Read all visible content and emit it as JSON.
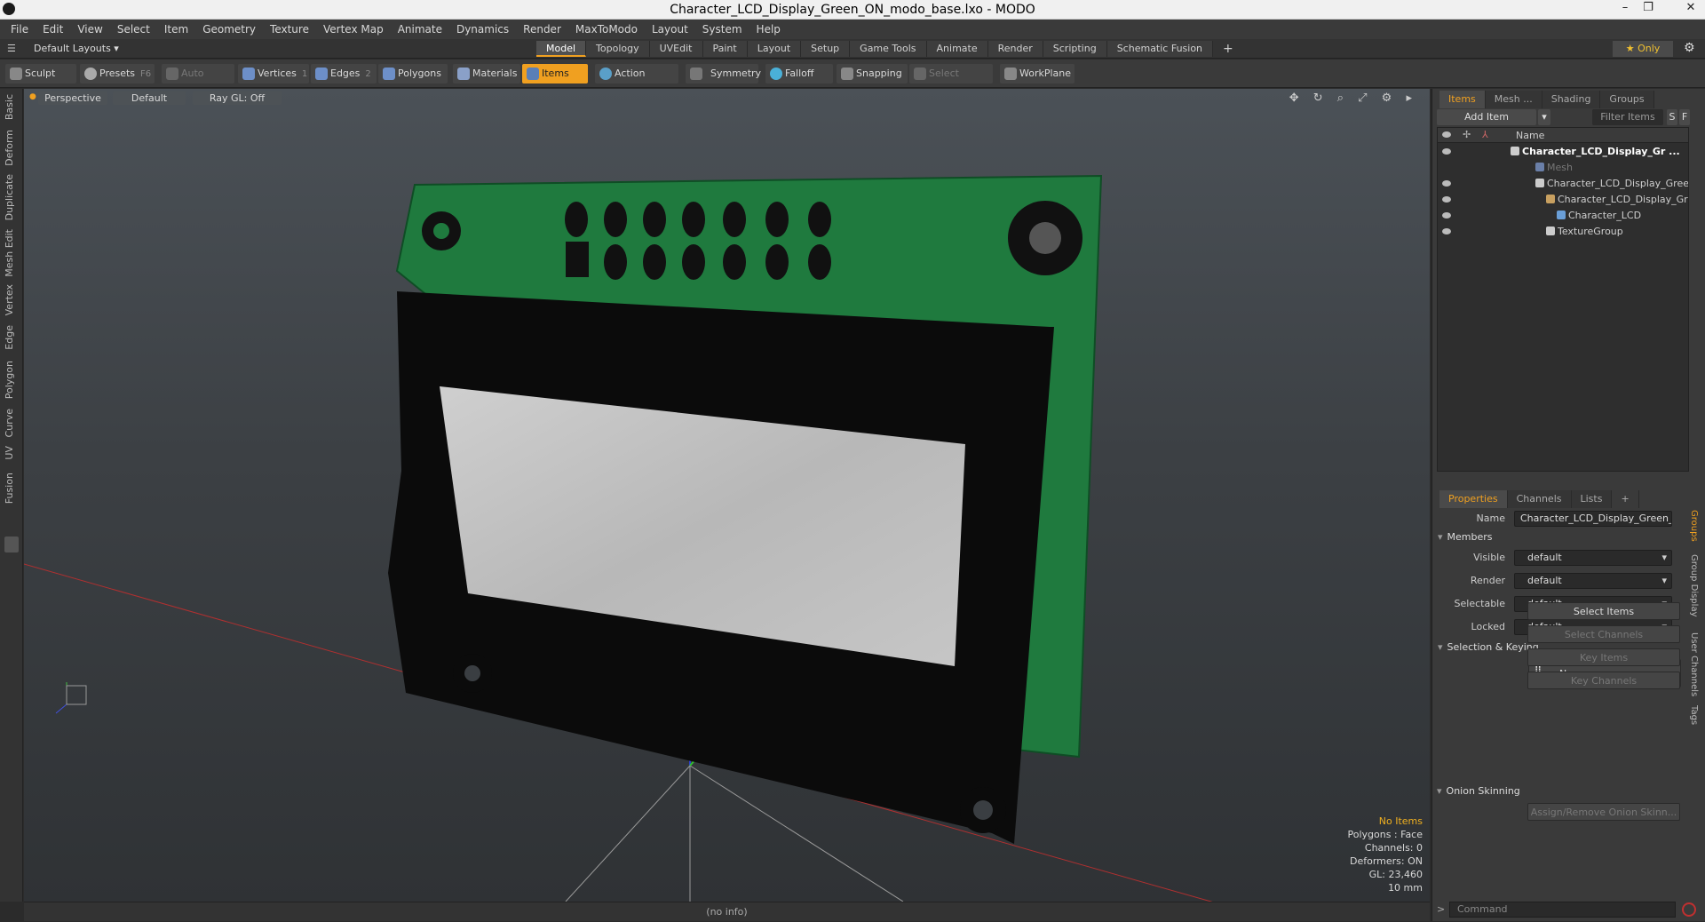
{
  "window": {
    "title": "Character_LCD_Display_Green_ON_modo_base.lxo - MODO",
    "minimize": "–",
    "restore": "❐",
    "close": "✕"
  },
  "menu": [
    "File",
    "Edit",
    "View",
    "Select",
    "Item",
    "Geometry",
    "Texture",
    "Vertex Map",
    "Animate",
    "Dynamics",
    "Render",
    "MaxToModo",
    "Layout",
    "System",
    "Help"
  ],
  "layout": {
    "preset": "Default Layouts ▾",
    "tabs": [
      "Model",
      "Topology",
      "UVEdit",
      "Paint",
      "Layout",
      "Setup",
      "Game Tools",
      "Animate",
      "Render",
      "Scripting",
      "Schematic Fusion"
    ],
    "active_tab": "Model",
    "add": "+",
    "only": "★  Only",
    "gear": "⚙"
  },
  "toolbar": {
    "sculpt": "Sculpt",
    "presets": "Presets",
    "presets_key": "F6",
    "auto_select": "Auto Select",
    "vertices": "Vertices",
    "vertices_key": "1",
    "edges": "Edges",
    "edges_key": "2",
    "polygons": "Polygons",
    "materials": "Materials",
    "items": "Items",
    "action_center": "Action Center",
    "symmetry": "Symmetry",
    "falloff": "Falloff",
    "snapping": "Snapping",
    "select_through": "Select Through",
    "workplane": "WorkPlane"
  },
  "left_tabs": [
    "Basic",
    "Deform",
    "Duplicate",
    "Mesh Edit",
    "Vertex",
    "Edge",
    "Polygon",
    "Curve",
    "UV",
    "Fusion"
  ],
  "viewport": {
    "view": "Perspective",
    "shading": "Default",
    "raygl": "Ray GL: Off",
    "icons": "✥ ↻ ⌕ ⤢ ⚙ ▸",
    "info": {
      "selection": "No Items",
      "polygons": "Polygons : Face",
      "channels": "Channels: 0",
      "deformers": "Deformers: ON",
      "gl": "GL: 23,460",
      "scale": "10 mm"
    }
  },
  "status": "(no info)",
  "items_panel": {
    "tabs": [
      "Items",
      "Mesh ...",
      "Shading",
      "Groups"
    ],
    "active_tab": "Items",
    "add_item": "Add Item",
    "filter": "Filter Items",
    "s_btn": "S",
    "f_btn": "F",
    "column_name": "Name",
    "rows": [
      {
        "label": "Character_LCD_Display_Gr ...",
        "indent": 0
      },
      {
        "label": "Mesh",
        "indent": 1
      },
      {
        "label": "Character_LCD_Display_Gree ...",
        "indent": 1
      },
      {
        "label": "Character_LCD_Display_Gr ...",
        "indent": 2
      },
      {
        "label": "Character_LCD",
        "indent": 3
      },
      {
        "label": "TextureGroup",
        "indent": 2
      }
    ]
  },
  "properties": {
    "tabs": [
      "Properties",
      "Channels",
      "Lists"
    ],
    "active_tab": "Properties",
    "add": "+",
    "name_label": "Name",
    "name_value": "Character_LCD_Display_Green_C",
    "members": "Members",
    "visible_label": "Visible",
    "visible_value": "default",
    "render_label": "Render",
    "render_value": "default",
    "selectable_label": "Selectable",
    "selectable_value": "default",
    "locked_label": "Locked",
    "locked_value": "default",
    "selection_keying": "Selection & Keying",
    "none": "None",
    "select_items": "Select Items",
    "select_channels": "Select Channels",
    "key_items": "Key Items",
    "key_channels": "Key Channels",
    "onion_skinning": "Onion Skinning",
    "assign_onion": "Assign/Remove Onion Skinn...",
    "side_tabs": [
      "Groups",
      "Group Display",
      "User Channels",
      "Tags"
    ],
    "command_placeholder": "Command"
  }
}
